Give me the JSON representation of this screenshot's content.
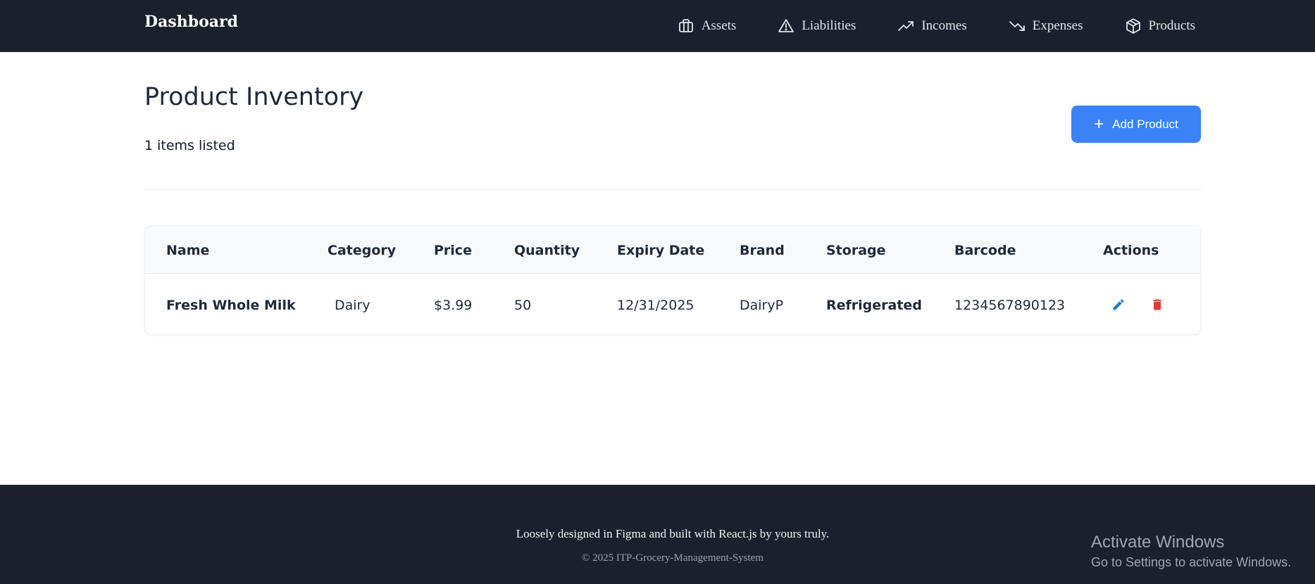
{
  "navbar": {
    "brand": "Dashboard",
    "links": [
      {
        "label": "Assets",
        "icon": "briefcase-icon"
      },
      {
        "label": "Liabilities",
        "icon": "warning-triangle-icon"
      },
      {
        "label": "Incomes",
        "icon": "trending-up-icon"
      },
      {
        "label": "Expenses",
        "icon": "trending-down-icon"
      },
      {
        "label": "Products",
        "icon": "package-icon"
      }
    ]
  },
  "header": {
    "title": "Product Inventory",
    "count_text": "1 items listed",
    "add_button_label": "Add Product",
    "add_button_icon": "plus-icon"
  },
  "table": {
    "columns": [
      "Name",
      "Category",
      "Price",
      "Quantity",
      "Expiry Date",
      "Brand",
      "Storage",
      "Barcode",
      "Actions"
    ],
    "rows": [
      {
        "name": "Fresh Whole Milk",
        "category": "Dairy",
        "price": "$3.99",
        "quantity": "50",
        "expiry": "12/31/2025",
        "brand": "DairyP",
        "storage": "Refrigerated",
        "barcode": "1234567890123"
      }
    ],
    "action_icons": [
      "pencil-icon",
      "trash-icon"
    ]
  },
  "footer": {
    "text": "Loosely designed in Figma and built with React.js by yours truly.",
    "copyright": "© 2025 ITP-Grocery-Management-System"
  },
  "windows_watermark": {
    "title": "Activate Windows",
    "subtitle": "Go to Settings to activate Windows."
  },
  "colors": {
    "navbar_bg": "#1b202c",
    "accent": "#3b82f6",
    "edit_icon": "#1d7fd1",
    "delete_icon": "#e53935"
  }
}
